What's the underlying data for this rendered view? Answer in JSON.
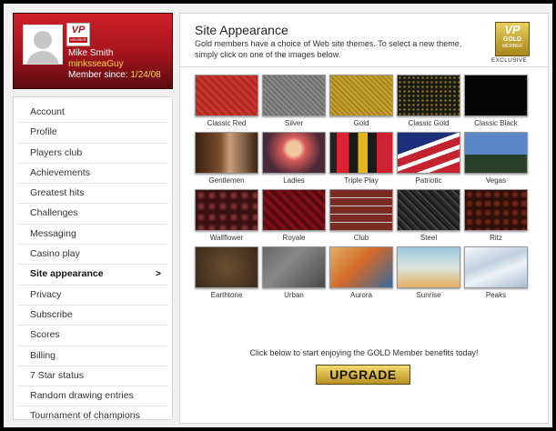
{
  "profile": {
    "name": "Mike Smith",
    "username": "minksseaGuy",
    "member_since_label": "Member since:",
    "member_since_date": "1/24/08",
    "badge_vp": "VP",
    "badge_member": "MEMBER"
  },
  "nav": {
    "items": [
      {
        "label": "Account"
      },
      {
        "label": "Profile"
      },
      {
        "label": "Players club"
      },
      {
        "label": "Achievements"
      },
      {
        "label": "Greatest hits"
      },
      {
        "label": "Challenges"
      },
      {
        "label": "Messaging"
      },
      {
        "label": "Casino play"
      },
      {
        "label": "Site appearance",
        "active": true,
        "chevron": ">"
      },
      {
        "label": "Privacy"
      },
      {
        "label": "Subscribe"
      },
      {
        "label": "Scores"
      },
      {
        "label": "Billing"
      },
      {
        "label": "7 Star status"
      },
      {
        "label": "Random drawing entries"
      },
      {
        "label": "Tournament of champions"
      }
    ]
  },
  "main": {
    "title": "Site Appearance",
    "description": "Gold members have a choice of Web site themes. To select a new theme, simply click on one of the images below.",
    "gold_badge": {
      "vp": "VP",
      "gold": "GOLD",
      "member": "MEMBER",
      "exclusive": "EXCLUSIVE"
    },
    "themes": [
      {
        "label": "Classic Red",
        "key": "classic-red"
      },
      {
        "label": "Silver",
        "key": "silver"
      },
      {
        "label": "Gold",
        "key": "gold"
      },
      {
        "label": "Classic Gold",
        "key": "classic-gold"
      },
      {
        "label": "Classic Black",
        "key": "classic-black"
      },
      {
        "label": "Gentlemen",
        "key": "gentlemen"
      },
      {
        "label": "Ladies",
        "key": "ladies"
      },
      {
        "label": "Triple Play",
        "key": "triple-play"
      },
      {
        "label": "Patriotic",
        "key": "patriotic"
      },
      {
        "label": "Vegas",
        "key": "vegas"
      },
      {
        "label": "Wallflower",
        "key": "wallflower"
      },
      {
        "label": "Royale",
        "key": "royale"
      },
      {
        "label": "Club",
        "key": "club"
      },
      {
        "label": "Steel",
        "key": "steel"
      },
      {
        "label": "Ritz",
        "key": "ritz"
      },
      {
        "label": "Earthtone",
        "key": "earthtone"
      },
      {
        "label": "Urban",
        "key": "urban"
      },
      {
        "label": "Aurora",
        "key": "aurora"
      },
      {
        "label": "Sunrise",
        "key": "sunrise"
      },
      {
        "label": "Peaks",
        "key": "peaks"
      }
    ],
    "cta_text": "Click below to start enjoying the GOLD Member benefits today!",
    "upgrade_label": "UPGRADE"
  },
  "colors": {
    "profile_red": "#b5121b",
    "username_yellow": "#ffd34d",
    "upgrade_gold": "#d4b040"
  }
}
